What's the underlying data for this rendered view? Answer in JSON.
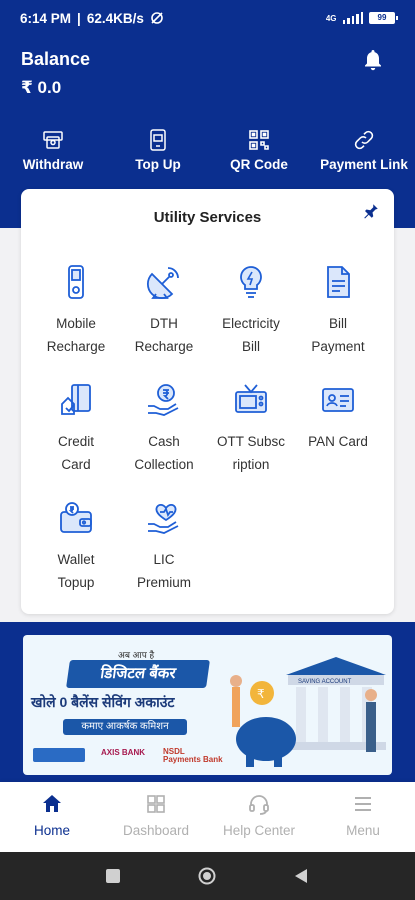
{
  "status": {
    "time": "6:14 PM",
    "speed": "62.4KB/s",
    "network": "4G",
    "battery": "99"
  },
  "balance": {
    "label": "Balance",
    "value": "₹  0.0"
  },
  "actions": [
    {
      "label": "Withdraw",
      "icon": "withdraw-icon"
    },
    {
      "label": "Top Up",
      "icon": "topup-icon"
    },
    {
      "label": "QR Code",
      "icon": "qr-code-icon"
    },
    {
      "label": "Payment Link",
      "icon": "link-icon"
    }
  ],
  "utility": {
    "title": "Utility Services",
    "items": [
      {
        "line1": "Mobile",
        "line2": "Recharge",
        "icon": "mobile-icon"
      },
      {
        "line1": "DTH",
        "line2": "Recharge",
        "icon": "satellite-dish-icon"
      },
      {
        "line1": "Electricity",
        "line2": "Bill",
        "icon": "bulb-icon"
      },
      {
        "line1": "Bill",
        "line2": "Payment",
        "icon": "document-icon"
      },
      {
        "line1": "Credit",
        "line2": "Card",
        "icon": "credit-card-icon"
      },
      {
        "line1": "Cash",
        "line2": "Collection",
        "icon": "cash-hand-icon"
      },
      {
        "line1": "OTT Subsc",
        "line2": "ription",
        "icon": "tv-icon"
      },
      {
        "line1": "PAN Card",
        "line2": "",
        "icon": "id-card-icon"
      },
      {
        "line1": "Wallet",
        "line2": "Topup",
        "icon": "wallet-icon"
      },
      {
        "line1": "LIC",
        "line2": "Premium",
        "icon": "heart-hand-icon"
      }
    ]
  },
  "banner": {
    "tag": "अब आप है",
    "title": "डिजिटल बैंकर",
    "subtitle": "खोले 0 बैलेंस सेविंग अकाउंट",
    "strip": "कमाए आकर्षक कमिशन",
    "bank1": "AXIS BANK",
    "bank2": "NSDL Payments Bank",
    "sign": "SAVING ACCOUNT"
  },
  "bottom_nav": [
    {
      "label": "Home",
      "icon": "home-icon",
      "active": true
    },
    {
      "label": "Dashboard",
      "icon": "dashboard-icon",
      "active": false
    },
    {
      "label": "Help Center",
      "icon": "headset-icon",
      "active": false
    },
    {
      "label": "Menu",
      "icon": "menu-icon",
      "active": false
    }
  ],
  "colors": {
    "primary": "#0b2f8f",
    "icon_blue": "#1f5fd6",
    "inactive": "#b0b0b0"
  }
}
